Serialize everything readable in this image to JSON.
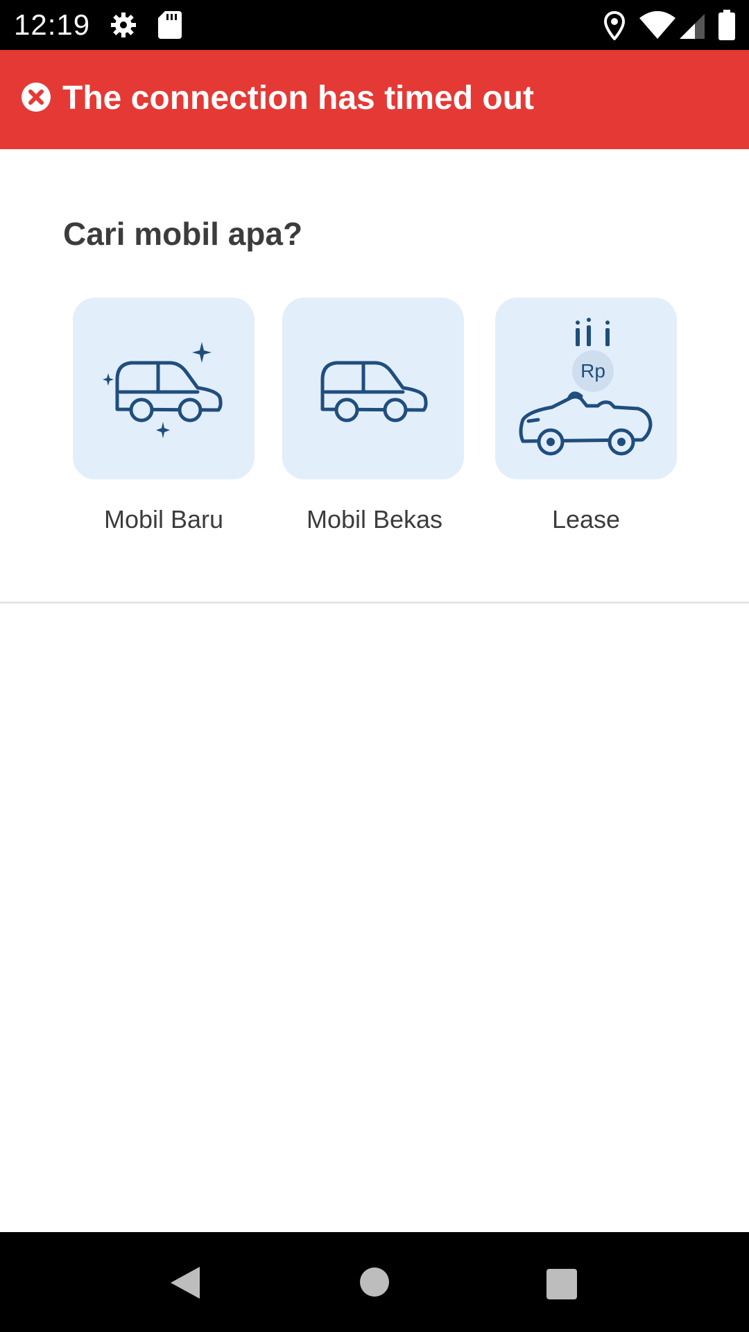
{
  "status_bar": {
    "time": "12:19",
    "icons": [
      "settings-icon",
      "sd-card-icon",
      "location-icon",
      "wifi-icon",
      "signal-icon",
      "battery-icon"
    ]
  },
  "error_banner": {
    "message": "The connection has timed out",
    "icon": "error-circle-icon",
    "color": "#e53935"
  },
  "section": {
    "title": "Cari mobil apa?",
    "categories": [
      {
        "label": "Mobil Baru",
        "icon": "new-car-icon"
      },
      {
        "label": "Mobil Bekas",
        "icon": "used-car-icon"
      },
      {
        "label": "Lease",
        "icon": "lease-car-icon",
        "badge": "Rp"
      }
    ],
    "card_color": "#e3eefb",
    "icon_color": "#1f4e7e"
  },
  "nav_bar": {
    "buttons": [
      "back-icon",
      "home-icon",
      "recents-icon"
    ]
  }
}
